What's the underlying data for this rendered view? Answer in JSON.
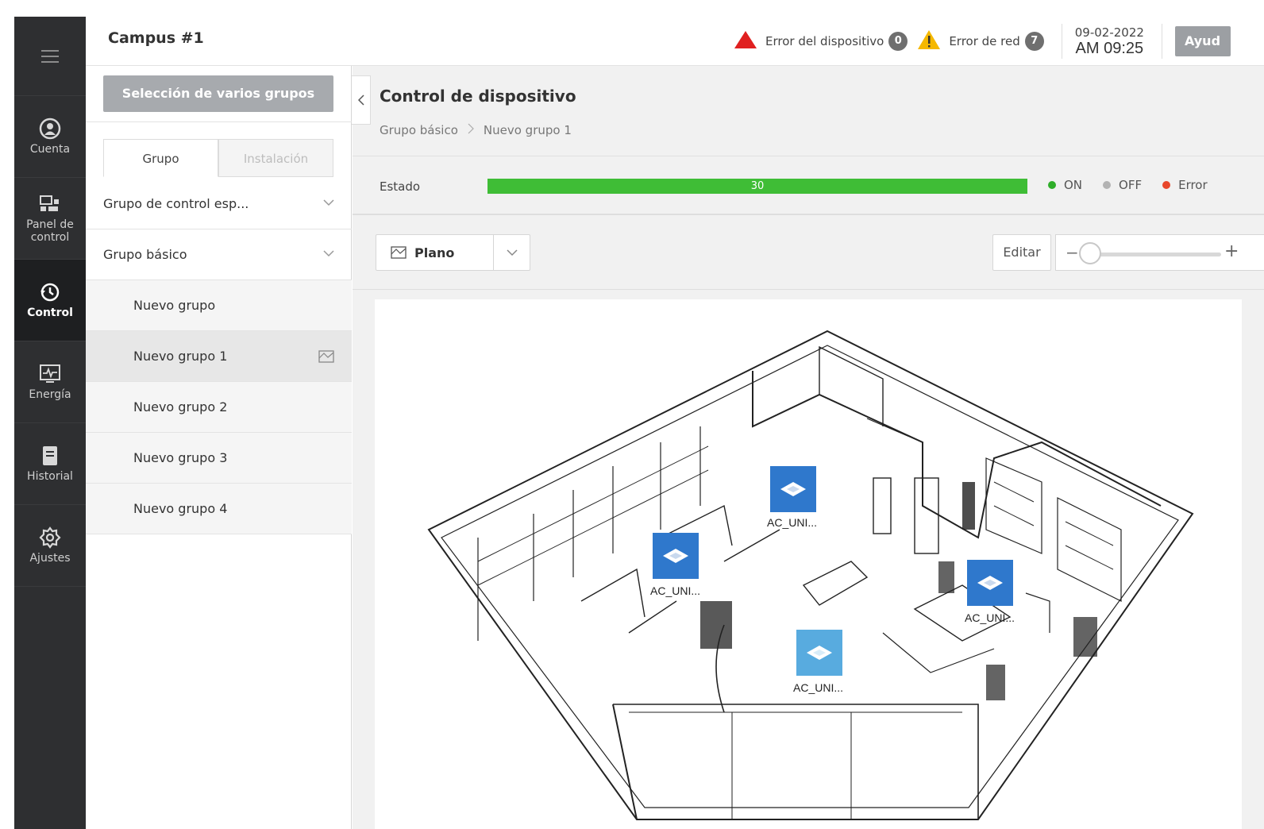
{
  "rail": {
    "items": [
      {
        "label": "Cuenta",
        "icon": "user-icon"
      },
      {
        "label": "Panel de control",
        "icon": "dashboard-icon"
      },
      {
        "label": "Control",
        "icon": "control-icon"
      },
      {
        "label": "Energía",
        "icon": "energy-monitor-icon"
      },
      {
        "label": "Historial",
        "icon": "history-icon"
      },
      {
        "label": "Ajustes",
        "icon": "settings-gear-icon"
      }
    ],
    "active": "Control"
  },
  "header": {
    "site": "Campus #1",
    "device_error_label": "Error del dispositivo",
    "device_error_count": "0",
    "network_error_label": "Error de red",
    "network_error_count": "7",
    "date": "09-02-2022",
    "time": "AM 09:25",
    "help_label": "Ayud"
  },
  "panel": {
    "multi_select_label": "Selección de varios grupos",
    "tabs": [
      "Grupo",
      "Instalación"
    ],
    "groups": [
      {
        "label": "Grupo de control esp..."
      },
      {
        "label": "Grupo básico"
      }
    ],
    "subgroups": [
      "Nuevo grupo",
      "Nuevo grupo 1",
      "Nuevo grupo 2",
      "Nuevo grupo 3",
      "Nuevo grupo 4"
    ],
    "selected": "Nuevo grupo 1"
  },
  "main": {
    "title": "Control de dispositivo",
    "breadcrumb": [
      "Grupo básico",
      "Nuevo grupo 1"
    ],
    "status_label": "Estado",
    "status_count": "30",
    "status_fraction_on": 1.0,
    "legend": [
      {
        "label": "ON",
        "color": "#2fae2a"
      },
      {
        "label": "OFF",
        "color": "#b3b3b3"
      },
      {
        "label": "Error",
        "color": "#e8472b"
      }
    ],
    "view_select": "Plano",
    "edit_label": "Editar",
    "zoom_minus": "−",
    "zoom_plus": "+",
    "devices": [
      {
        "label": "AC_UNI...",
        "state": "selected"
      },
      {
        "label": "AC_UNI...",
        "state": "selected"
      },
      {
        "label": "AC_UNI...",
        "state": "selected"
      },
      {
        "label": "AC_UNI...",
        "state": "normal"
      }
    ]
  },
  "colors": {
    "rail_bg": "#2e2f31",
    "progress_green": "#3fbd36",
    "device_blue": "#2f78cc",
    "device_light_blue": "#58abdf",
    "error_red": "#e02020",
    "warning_yellow": "#f5b800"
  }
}
